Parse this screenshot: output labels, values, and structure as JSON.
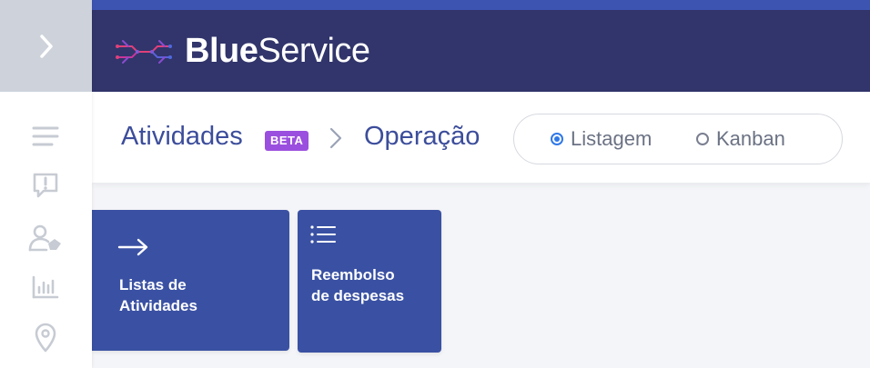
{
  "brand": {
    "bold": "Blue",
    "light": "Service"
  },
  "breadcrumb": {
    "section": "Atividades",
    "badge": "BETA",
    "current": "Operação"
  },
  "view_toggle": {
    "options": [
      {
        "label": "Listagem",
        "selected": true
      },
      {
        "label": "Kanban",
        "selected": false
      }
    ]
  },
  "cards": [
    {
      "line1": "Listas de",
      "line2": "Atividades",
      "icon": "arrow-right-icon"
    },
    {
      "line1": "Reembolso",
      "line2": "de despesas",
      "icon": "list-icon"
    }
  ],
  "sidebar": {
    "toggle_icon": "chevron-right-icon",
    "icons": [
      "menu-icon",
      "alert-message-icon",
      "user-tag-icon",
      "bar-chart-icon",
      "location-pin-icon"
    ]
  },
  "colors": {
    "accent_strip": "#3d54b1",
    "topbar": "#31356b",
    "card": "#3a51a3",
    "beta_badge": "#9b4fde",
    "radio_selected": "#2f78e8"
  }
}
